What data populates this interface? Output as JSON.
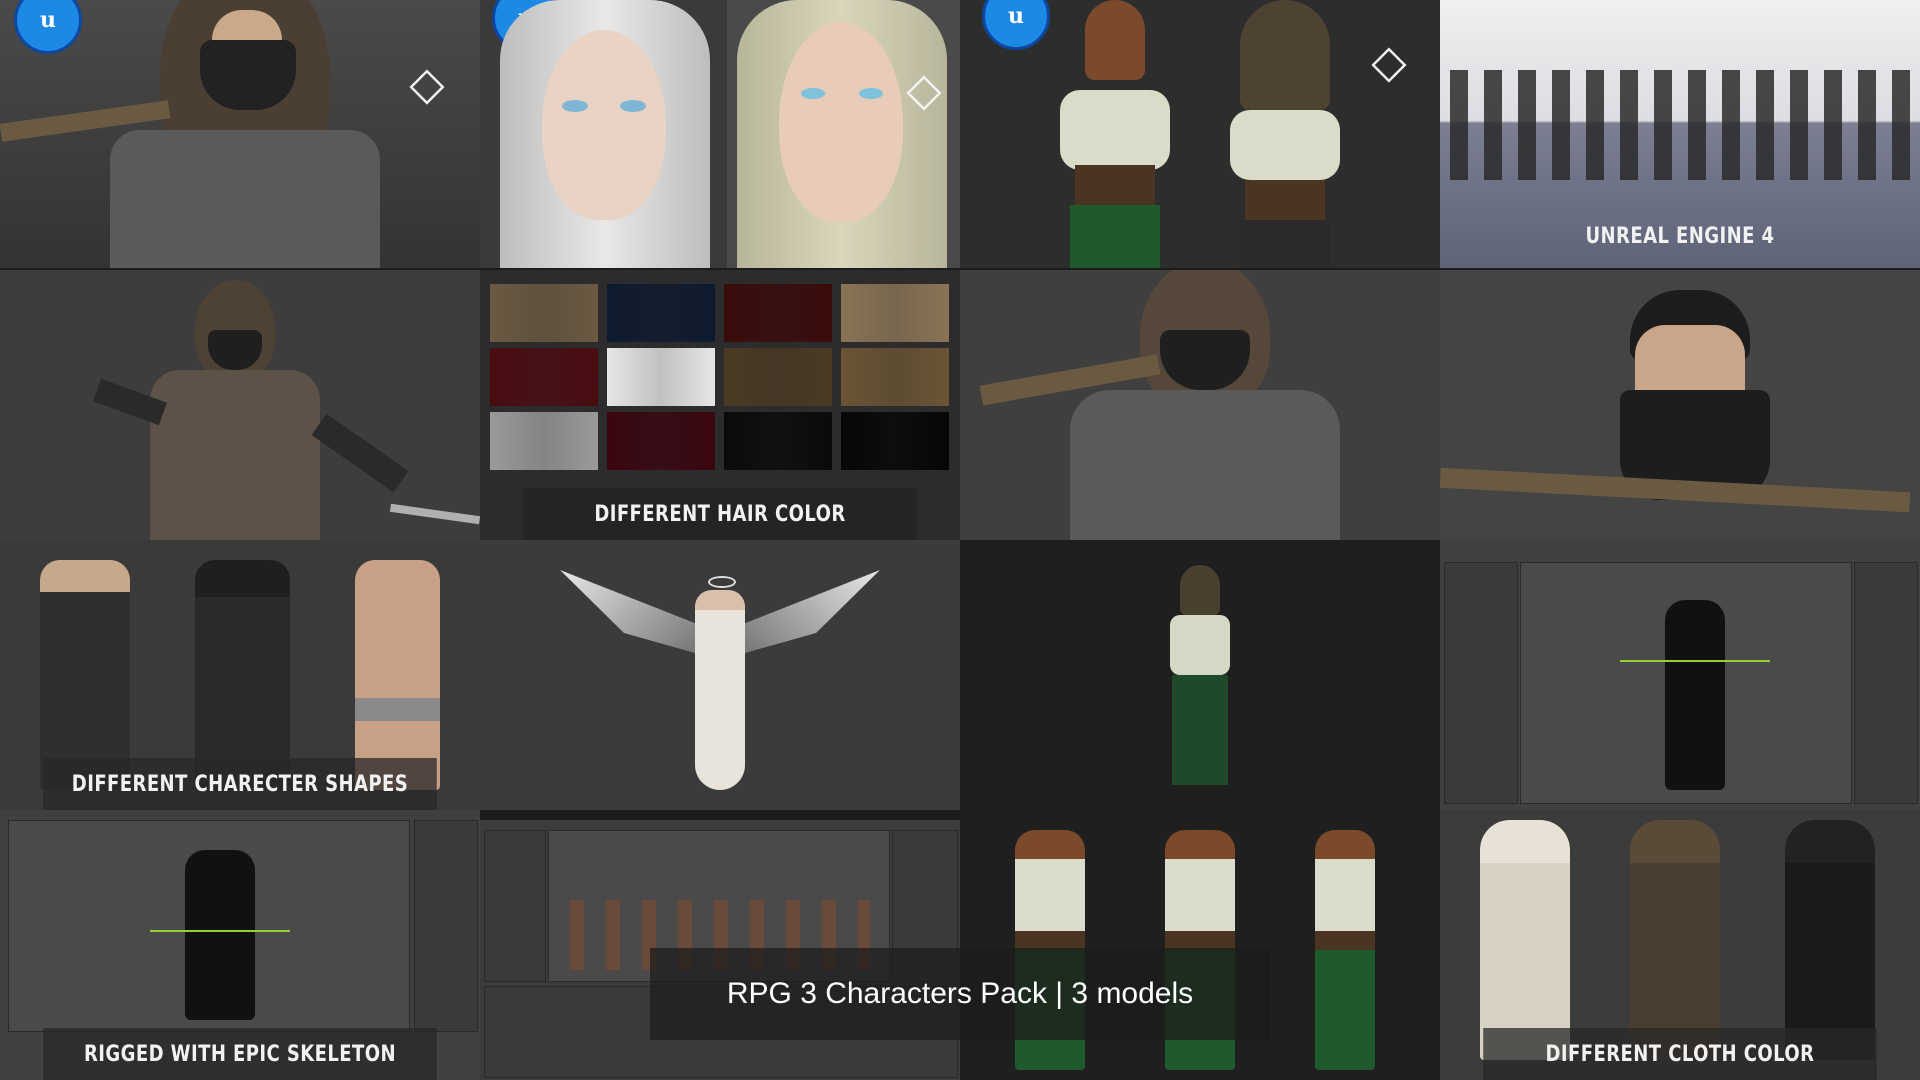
{
  "banner": {
    "title": "RPG 3 Characters Pack | 3 models"
  },
  "captions": {
    "unreal": "UNREAL ENGINE 4",
    "hair": "DIFFERENT HAIR COLOR",
    "shapes": "DIFFERENT CHARECTER SHAPES",
    "rigged": "RIGGED WITH EPIC SKELETON",
    "cloth": "DIFFERENT CLOTH COLOR"
  },
  "badges": {
    "ue_letter": "u",
    "unity_glyph": "◇"
  },
  "colors": {
    "background": "#1c1c1c",
    "tile_gray": "#3b3b3b",
    "ue_blue": "#1e88e5",
    "caption_text": "#f2f2f2"
  },
  "hair_swatches": [
    "#6b5a42",
    "#0e1a2e",
    "#3a0b0b",
    "#8a7456",
    "#4a0c12",
    "#e6e6e6",
    "#4a3a24",
    "#6a5434",
    "#9a9a9a",
    "#3a0610",
    "#0a0a0a",
    "#060606"
  ]
}
